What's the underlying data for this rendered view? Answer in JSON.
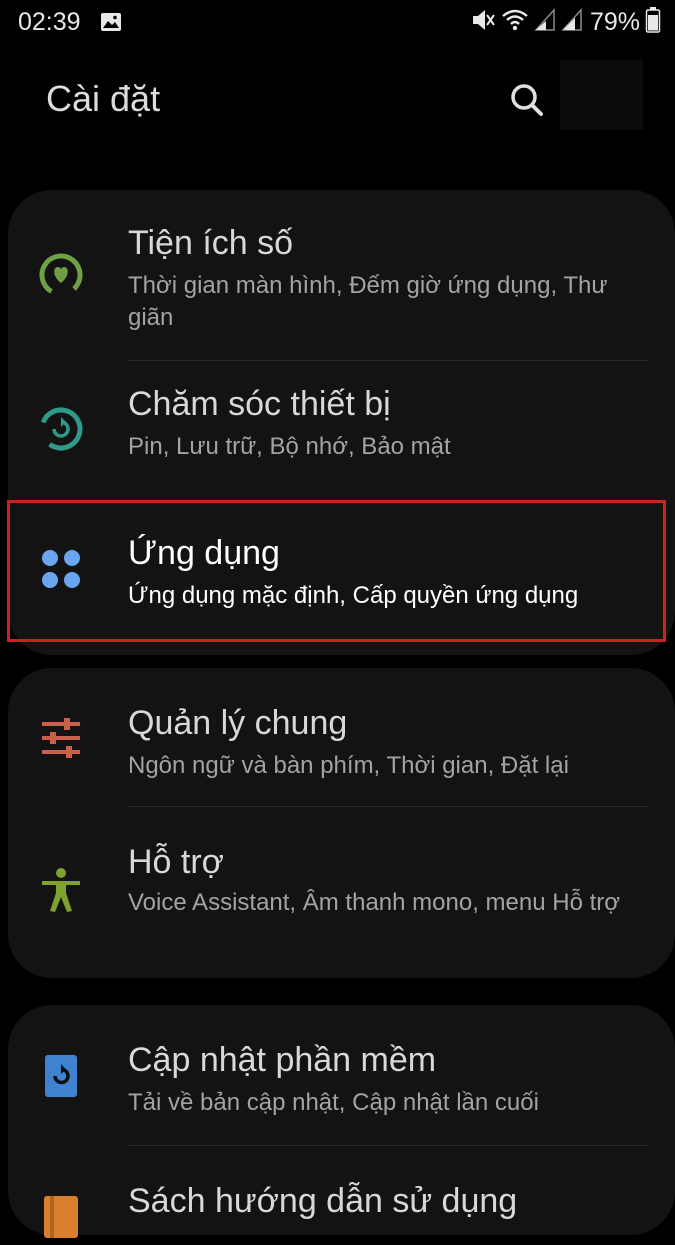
{
  "status_bar": {
    "time": "02:39",
    "battery_percent": "79%",
    "icons": [
      "gallery-icon",
      "mute-icon",
      "wifi-icon",
      "signal-icon",
      "signal-icon",
      "battery-icon"
    ]
  },
  "header": {
    "title": "Cài đặt",
    "search_icon": "search-icon"
  },
  "settings": {
    "items": [
      {
        "title": "Tiện ích số",
        "subtitle": "Thời gian màn hình, Đếm giờ ứng dụng, Thư giãn",
        "icon": "digital-wellbeing-icon",
        "color": "#6fa043"
      },
      {
        "title": "Chăm sóc thiết bị",
        "subtitle": "Pin, Lưu trữ, Bộ nhớ, Bảo mật",
        "icon": "device-care-icon",
        "color": "#2e9a8a"
      },
      {
        "title": "Ứng dụng",
        "subtitle": "Ứng dụng mặc định, Cấp quyền ứng dụng",
        "icon": "apps-icon",
        "color": "#6aa6f0"
      },
      {
        "title": "Quản lý chung",
        "subtitle": "Ngôn ngữ và bàn phím, Thời gian, Đặt lại",
        "icon": "general-management-icon",
        "color": "#c96049"
      },
      {
        "title": "Hỗ trợ",
        "subtitle": "Voice Assistant, Âm thanh mono, menu Hỗ trợ",
        "icon": "accessibility-icon",
        "color": "#7fa12e"
      },
      {
        "title": "Cập nhật phần mềm",
        "subtitle": "Tải về bản cập nhật, Cập nhật lần cuối",
        "icon": "software-update-icon",
        "color": "#3f83d0"
      },
      {
        "title": "Sách hướng dẫn sử dụng",
        "subtitle": "",
        "icon": "user-manual-icon",
        "color": "#d9802e"
      }
    ]
  },
  "colors": {
    "background": "#000000",
    "card": "#131313",
    "highlight_border": "#d01f1f"
  }
}
